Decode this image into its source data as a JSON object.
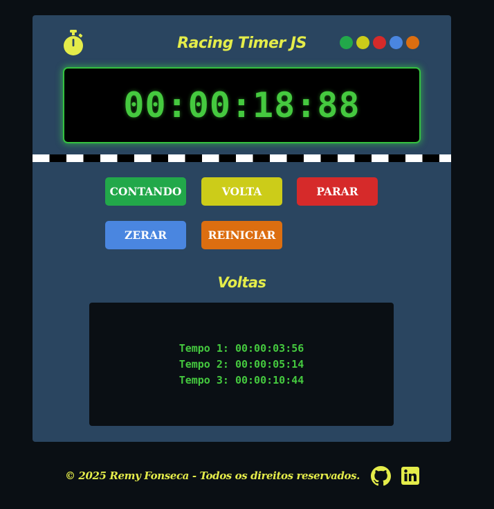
{
  "header": {
    "title": "Racing Timer JS",
    "stopwatch_icon": "stopwatch-icon",
    "dots": [
      "#22a84a",
      "#cccc19",
      "#d62a2a",
      "#4a86e0",
      "#dc6e10"
    ]
  },
  "display": {
    "time": "00:00:18:88"
  },
  "buttons": {
    "start_label": "CONTANDO",
    "lap_label": "VOLTA",
    "stop_label": "PARAR",
    "reset_label": "ZERAR",
    "restart_label": "REINICIAR"
  },
  "laps": {
    "title": "Voltas",
    "items": [
      "Tempo 1: 00:00:03:56",
      "Tempo 2: 00:00:05:14",
      "Tempo 3: 00:00:10:44"
    ]
  },
  "footer": {
    "copyright": "© 2025 Remy Fonseca - Todos os direitos reservados.",
    "icons": [
      "github-icon",
      "linkedin-icon"
    ]
  },
  "colors": {
    "accent_yellow": "#e4ec4a",
    "digit_green": "#45c93f",
    "card_bg": "#2a4560",
    "page_bg": "#0a0f14"
  }
}
